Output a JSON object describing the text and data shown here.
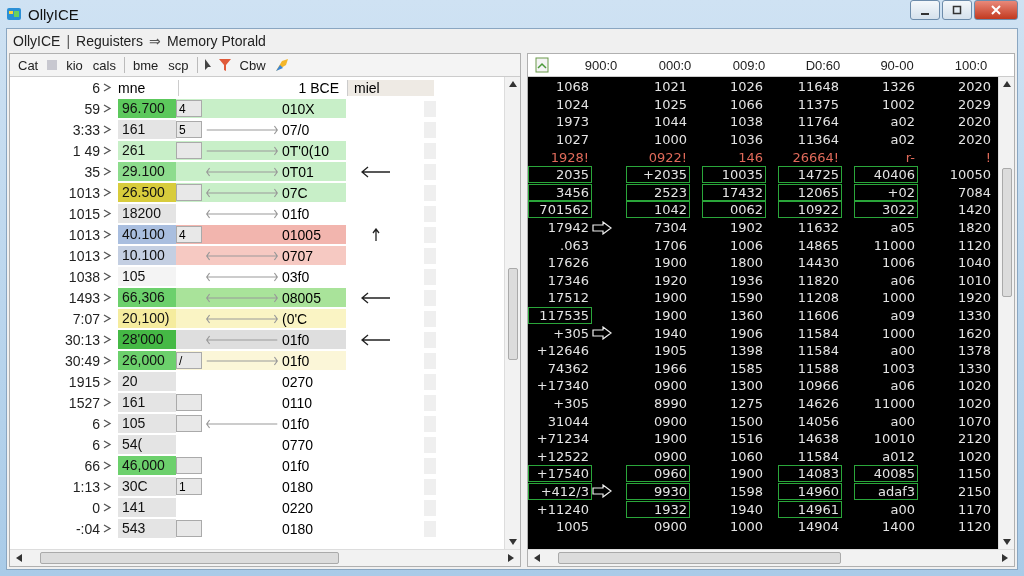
{
  "window": {
    "title": "OllyICE"
  },
  "breadcrumb": [
    {
      "kind": "item",
      "label": "OllyICE"
    },
    {
      "kind": "separator",
      "label": "|"
    },
    {
      "kind": "item",
      "label": "Reguisters"
    },
    {
      "kind": "separator",
      "label": "⇒"
    },
    {
      "kind": "item",
      "label": "Memory Ptorald"
    }
  ],
  "toolbar": [
    {
      "kind": "text",
      "label": "Cat"
    },
    {
      "kind": "square"
    },
    {
      "kind": "text",
      "label": "kio"
    },
    {
      "kind": "text",
      "label": "cals"
    },
    {
      "kind": "separator"
    },
    {
      "kind": "text",
      "label": "bme"
    },
    {
      "kind": "text",
      "label": "scp"
    },
    {
      "kind": "separator"
    },
    {
      "kind": "cursor"
    },
    {
      "kind": "funnel"
    },
    {
      "kind": "text",
      "label": "Cbw"
    },
    {
      "kind": "paint"
    }
  ],
  "left_panel": {
    "header": {
      "address": "6",
      "column_1": "mne",
      "column_2": "1 BCE",
      "column_3": "miel"
    },
    "rows": [
      {
        "address": "59",
        "value": "96.700",
        "color": "#5cc85c",
        "box": true,
        "flag": "4",
        "band": {
          "color": "#c8efc8"
        },
        "code": "010X"
      },
      {
        "address": "3:33",
        "value": "161",
        "color": "#e4e4e4",
        "box": true,
        "flag": "5",
        "link": {
          "kind": "right"
        },
        "code": "07/0"
      },
      {
        "address": "1 49",
        "value": "261",
        "color": "#c8efc8",
        "box": true,
        "band": {
          "color": "#c8efc8"
        },
        "link": {
          "kind": "right"
        },
        "code": "0T'0(10"
      },
      {
        "address": "35",
        "value": "29.100",
        "color": "#8ddc8d",
        "box": false,
        "band": {
          "color": "#c8efc8"
        },
        "link": {
          "kind": "both"
        },
        "code": "0T01",
        "note": {
          "kind": "left"
        }
      },
      {
        "address": "1013",
        "value": "26.500",
        "color": "#d8cc3c",
        "box": true,
        "band": {
          "color": "#c8efc8"
        },
        "link": {
          "kind": "both"
        },
        "code": "07C"
      },
      {
        "address": "1015",
        "value": "18200",
        "color": "#e4e4e4",
        "box": false,
        "link": {
          "kind": "both"
        },
        "code": "01f0"
      },
      {
        "address": "1013",
        "value": "40.100",
        "color": "#a9bedf",
        "box": true,
        "flag": "4",
        "band": {
          "color": "#f2b5ae"
        },
        "code": "01005",
        "note": {
          "kind": "up"
        }
      },
      {
        "address": "1013",
        "value": "10.100",
        "color": "#c4cfe2",
        "box": false,
        "band": {
          "color": "#f6c9c2"
        },
        "link": {
          "kind": "both"
        },
        "code": "0707"
      },
      {
        "address": "1038",
        "value": "105",
        "color": "#f4f4f4",
        "box": false,
        "link": {
          "kind": "both"
        },
        "code": "03f0"
      },
      {
        "address": "1493",
        "value": "66,306",
        "color": "#6cd06c",
        "box": false,
        "band": {
          "color": "#a9e39a"
        },
        "link": {
          "kind": "both"
        },
        "code": "08005",
        "note": {
          "kind": "left"
        }
      },
      {
        "address": "7:07",
        "value": "20,100)",
        "color": "#f5ec9e",
        "box": false,
        "band": {
          "color": "#faf4c4"
        },
        "link": {
          "kind": "both"
        },
        "code": "(0'C"
      },
      {
        "address": "30:13",
        "value": "28'000",
        "color": "#45b945",
        "box": false,
        "band": {
          "color": "#dedede"
        },
        "link": {
          "kind": "left"
        },
        "code": "01f0",
        "note": {
          "kind": "left"
        }
      },
      {
        "address": "30:49",
        "value": "26,000",
        "color": "#6cd06c",
        "box": true,
        "flag": "/",
        "band": {
          "color": "#fbf6d8"
        },
        "link": {
          "kind": "right"
        },
        "code": "01f0"
      },
      {
        "address": "1915",
        "value": "20",
        "color": "#e4e4e4",
        "box": false,
        "code": "0270"
      },
      {
        "address": "1527",
        "value": "161",
        "color": "#e4e4e4",
        "box": true,
        "code": "0110"
      },
      {
        "address": "6",
        "value": "105",
        "color": "#e4e4e4",
        "box": true,
        "link": {
          "kind": "left"
        },
        "code": "01f0"
      },
      {
        "address": "6",
        "value": "54(",
        "color": "#e4e4e4",
        "box": false,
        "code": "0770"
      },
      {
        "address": "66",
        "value": "46,000",
        "color": "#6cd06c",
        "box": true,
        "code": "01f0"
      },
      {
        "address": "1:13",
        "value": "30C",
        "color": "#e4e4e4",
        "box": true,
        "flag": "1",
        "code": "0180"
      },
      {
        "address": "0",
        "value": "141",
        "color": "#e4e4e4",
        "box": false,
        "code": "0220"
      },
      {
        "address": "-:04",
        "value": "543",
        "color": "#e4e4e4",
        "box": true,
        "code": "0180"
      }
    ]
  },
  "right_panel": {
    "columns": [
      "900:0",
      "000:0",
      "009:0",
      "D0:60",
      "90-00",
      "100:0"
    ],
    "rows": [
      {
        "cells": [
          "1068",
          "1021",
          "1026",
          "11648",
          "1326",
          "2020"
        ],
        "alert": false,
        "pointer": false
      },
      {
        "cells": [
          "1024",
          "1025",
          "1066",
          "11375",
          "1002",
          "2029"
        ],
        "alert": false,
        "pointer": false
      },
      {
        "cells": [
          "1973",
          "1044",
          "1038",
          "11764",
          "a02",
          "2020"
        ],
        "alert": false,
        "pointer": false
      },
      {
        "cells": [
          "1027",
          "1000",
          "1036",
          "11364",
          "a02",
          "2020"
        ],
        "alert": false,
        "pointer": false
      },
      {
        "cells": [
          "1928!",
          "0922!",
          "146",
          "26664!",
          "r-",
          "!"
        ],
        "alert": true,
        "pointer": false
      },
      {
        "cells": [
          "2035",
          "+2035",
          "10035",
          "14725",
          "40406",
          "10050"
        ],
        "boxed": [
          true,
          true,
          true,
          true,
          true,
          false
        ],
        "alert": false,
        "pointer": false
      },
      {
        "cells": [
          "3456",
          "2523",
          "17432",
          "12065",
          "+02",
          "7084"
        ],
        "boxed": [
          true,
          true,
          true,
          true,
          true,
          false
        ],
        "alert": false,
        "pointer": false
      },
      {
        "cells": [
          "701562",
          "1042",
          "0062",
          "10922",
          "3022",
          "1420"
        ],
        "boxed": [
          true,
          true,
          true,
          true,
          true,
          false
        ],
        "alert": false,
        "pointer": false
      },
      {
        "cells": [
          "17942",
          "7304",
          "1902",
          "11632",
          "a05",
          "1820"
        ],
        "alert": false,
        "pointer": true
      },
      {
        "cells": [
          ".063",
          "1706",
          "1006",
          "14865",
          "11000",
          "1120"
        ],
        "alert": false,
        "pointer": false
      },
      {
        "cells": [
          "17626",
          "1900",
          "1800",
          "14430",
          "1006",
          "1040"
        ],
        "alert": false,
        "pointer": false
      },
      {
        "cells": [
          "17346",
          "1920",
          "1936",
          "11820",
          "a06",
          "1010"
        ],
        "alert": false,
        "pointer": false
      },
      {
        "cells": [
          "17512",
          "1900",
          "1590",
          "11208",
          "1000",
          "1920"
        ],
        "alert": false,
        "pointer": false
      },
      {
        "cells": [
          "117535",
          "1900",
          "1360",
          "11606",
          "a09",
          "1330"
        ],
        "boxed": [
          true,
          false,
          false,
          false,
          false,
          false
        ],
        "alert": false,
        "pointer": false
      },
      {
        "cells": [
          "+305",
          "1940",
          "1906",
          "11584",
          "1000",
          "1620"
        ],
        "alert": false,
        "pointer": true
      },
      {
        "cells": [
          "+12646",
          "1905",
          "1398",
          "11584",
          "a00",
          "1378"
        ],
        "alert": false,
        "pointer": false
      },
      {
        "cells": [
          "74362",
          "1966",
          "1585",
          "11588",
          "1003",
          "1330"
        ],
        "alert": false,
        "pointer": false
      },
      {
        "cells": [
          "+17340",
          "0900",
          "1300",
          "10966",
          "a06",
          "1020"
        ],
        "alert": false,
        "pointer": false
      },
      {
        "cells": [
          "+305",
          "8990",
          "1275",
          "14626",
          "11000",
          "1020"
        ],
        "alert": false,
        "pointer": false
      },
      {
        "cells": [
          "31044",
          "0900",
          "1500",
          "14056",
          "a00",
          "1070"
        ],
        "alert": false,
        "pointer": false
      },
      {
        "cells": [
          "+71234",
          "1900",
          "1516",
          "14638",
          "10010",
          "2120"
        ],
        "alert": false,
        "pointer": false
      },
      {
        "cells": [
          "+12522",
          "0900",
          "1060",
          "11584",
          "a012",
          "1020"
        ],
        "alert": false,
        "pointer": false
      },
      {
        "cells": [
          "+17540",
          "0960",
          "1900",
          "14083",
          "40085",
          "1150"
        ],
        "boxed": [
          true,
          true,
          false,
          true,
          true,
          false
        ],
        "alert": false,
        "pointer": false
      },
      {
        "cells": [
          "+412/3",
          "9930",
          "1598",
          "14960",
          "adaf3",
          "2150"
        ],
        "boxed": [
          true,
          true,
          false,
          true,
          true,
          false
        ],
        "alert": false,
        "pointer": true
      },
      {
        "cells": [
          "+11240",
          "1932",
          "1940",
          "14961",
          "a00",
          "1170"
        ],
        "boxed": [
          false,
          true,
          false,
          true,
          false,
          false
        ],
        "alert": false,
        "pointer": false
      },
      {
        "cells": [
          "1005",
          "0900",
          "1000",
          "14904",
          "1400",
          "1120"
        ],
        "alert": false,
        "pointer": false
      }
    ]
  }
}
